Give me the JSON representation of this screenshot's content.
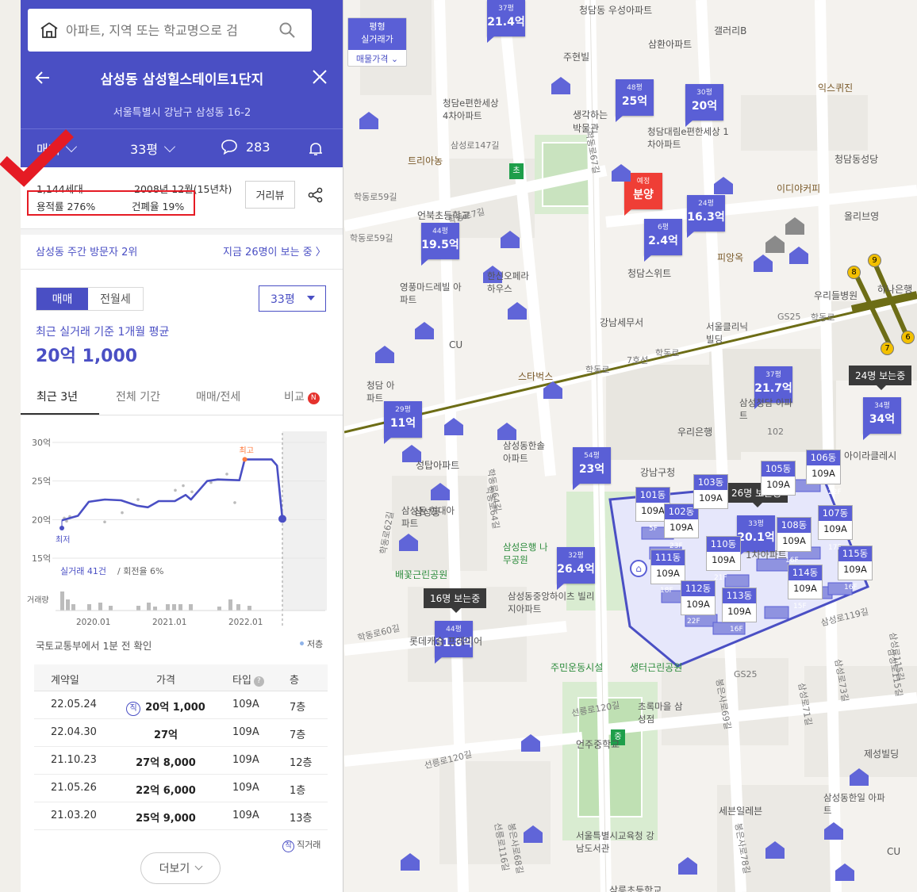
{
  "search": {
    "placeholder": "아파트, 지역 또는 학교명으로 검"
  },
  "header": {
    "title": "삼성동 삼성힐스테이트1단지",
    "address": "서울특별시 강남구 삼성동 16-2",
    "tabs": {
      "deal": "매매",
      "size": "33평",
      "comments": "283"
    }
  },
  "summary": {
    "households": "1,144세대",
    "built": "2008년 12월(15년차)",
    "far": "용적률 276%",
    "bcr": "건폐율 19%",
    "distance_view": "거리뷰"
  },
  "visit": {
    "rank": "삼성동 주간 방문자 2위",
    "viewing": "지금 26명이 보는 중 〉"
  },
  "price": {
    "mode_on": "매매",
    "mode_off": "전월세",
    "size_select": "33평",
    "avg_label": "최근 실거래 기준 1개월 평균",
    "avg_value": "20억 1,000"
  },
  "period_tabs": [
    "최근 3년",
    "전체 기간",
    "매매/전세",
    "비교"
  ],
  "compare_badge": "N",
  "chart_data": {
    "type": "line",
    "y_labels": [
      "30억",
      "25억",
      "20억",
      "15억"
    ],
    "x_labels": [
      "2020.01",
      "2021.01",
      "2022.01"
    ],
    "ylim": [
      15,
      30
    ],
    "series": [
      {
        "values": [
          {
            "x": "2019.06",
            "y": 19.9
          },
          {
            "x": "2019.09",
            "y": 20.5
          },
          {
            "x": "2019.11",
            "y": 22.3
          },
          {
            "x": "2020.02",
            "y": 22.6
          },
          {
            "x": "2020.05",
            "y": 22.5
          },
          {
            "x": "2020.08",
            "y": 21.8
          },
          {
            "x": "2020.10",
            "y": 21.6
          },
          {
            "x": "2020.12",
            "y": 22.4
          },
          {
            "x": "2021.03",
            "y": 22.4
          },
          {
            "x": "2021.05",
            "y": 23.2
          },
          {
            "x": "2021.06",
            "y": 22.6
          },
          {
            "x": "2021.09",
            "y": 25.0
          },
          {
            "x": "2021.11",
            "y": 25.2
          },
          {
            "x": "2022.03",
            "y": 25.1
          },
          {
            "x": "2022.04",
            "y": 27.8
          },
          {
            "x": "2022.06",
            "y": 27.8
          },
          {
            "x": "2022.09",
            "y": 27.8
          },
          {
            "x": "2022.10",
            "y": 27.0
          },
          {
            "x": "2022.11",
            "y": 20.1
          }
        ]
      }
    ],
    "annotations": {
      "high": "최고",
      "low": "최저"
    },
    "volume_label": "거래량",
    "stats_count": "실거래 41건",
    "stats_rotation": "/ 회전율 6%"
  },
  "confirm": "국토교통부에서 1분 전 확인",
  "low_legend": "저층",
  "table": {
    "headers": [
      "계약일",
      "가격",
      "타입",
      "층"
    ],
    "rows": [
      {
        "date": "22.05.24",
        "price": "20억 1,000",
        "type": "109A",
        "floor": "7층",
        "direct": true
      },
      {
        "date": "22.04.30",
        "price": "27억",
        "type": "109A",
        "floor": "7층",
        "direct": false
      },
      {
        "date": "21.10.23",
        "price": "27억 8,000",
        "type": "109A",
        "floor": "12층",
        "direct": false
      },
      {
        "date": "21.05.26",
        "price": "22억 6,000",
        "type": "109A",
        "floor": "1층",
        "direct": false
      },
      {
        "date": "21.03.20",
        "price": "25억 9,000",
        "type": "109A",
        "floor": "13층",
        "direct": false
      }
    ],
    "direct_mark": "직",
    "direct_legend": "직거래"
  },
  "more": "더보기",
  "map": {
    "type_toggle": "평형",
    "type_toggle2": "실거래가",
    "listing_toggle": "매물가격",
    "markers": [
      {
        "p": "37평",
        "v": "21.4억"
      },
      {
        "p": "48평",
        "v": "25억"
      },
      {
        "p": "30평",
        "v": "20억"
      },
      {
        "p": "예정",
        "v": "분양"
      },
      {
        "p": "6평",
        "v": "2.4억"
      },
      {
        "p": "24평",
        "v": "16.3억"
      },
      {
        "p": "44평",
        "v": "19.5억"
      },
      {
        "p": "37평",
        "v": "21.7억"
      },
      {
        "p": "34평",
        "v": "34억"
      },
      {
        "p": "29평",
        "v": "11억"
      },
      {
        "p": "54평",
        "v": "23억"
      },
      {
        "p": "33평",
        "v": "20.1억"
      },
      {
        "p": "32평",
        "v": "26.4억"
      },
      {
        "p": "44평",
        "v": "31.8억"
      }
    ],
    "bubbles": [
      "24명 보는중",
      "26명 보는중",
      "16명 보는중"
    ],
    "dongs": [
      {
        "d": "101동",
        "t": "109A",
        "f": "5F"
      },
      {
        "d": "102동",
        "t": "109A",
        "f": "23F"
      },
      {
        "d": "103동",
        "t": "109A",
        "f": ""
      },
      {
        "d": "105동",
        "t": "109A",
        "f": ""
      },
      {
        "d": "106동",
        "t": "109A",
        "f": "22F"
      },
      {
        "d": "107동",
        "t": "109A",
        "f": "17F"
      },
      {
        "d": "108동",
        "t": "109A",
        "f": "16F"
      },
      {
        "d": "110동",
        "t": "109A",
        "f": "21F"
      },
      {
        "d": "111동",
        "t": "109A",
        "f": "18F"
      },
      {
        "d": "112동",
        "t": "109A",
        "f": "22F"
      },
      {
        "d": "113동",
        "t": "109A",
        "f": "16F"
      },
      {
        "d": "114동",
        "t": "109A",
        "f": "15F"
      },
      {
        "d": "115동",
        "t": "109A",
        "f": "16F"
      }
    ],
    "labels": [
      "청담동 우성아파트",
      "갤러리B",
      "삼환아파트",
      "주현빌",
      "익스퀴진",
      "청담e편한세상 4차아파트",
      "생각하는 박물관",
      "청담대림e편한세상 1차아파트",
      "삼성로147길",
      "트리아농",
      "청담동성당",
      "이디야커피",
      "올리브영",
      "학동로59길",
      "언북초등학교",
      "학동로59길",
      "영풍마드레빌 아파트",
      "한신오페라 하우스",
      "청담스위트",
      "피앙옥",
      "하나은행",
      "우리들병원",
      "GS25",
      "학동로",
      "서울클리닉 빌딩",
      "강남세무서",
      "CU",
      "스타벅스",
      "학동로",
      "7호선",
      "학동로",
      "청담 아파트",
      "삼성청담 아파트",
      "102",
      "우리은행",
      "아이라클레시",
      "삼성동한솔 아파트",
      "성탑아파트",
      "강남구청",
      "삼성동 현대아파트",
      "학동로64길",
      "배꽃근린공원",
      "삼성은행 나무공원",
      "삼성동중앙하이츠 빌리지아파트",
      "롯데캐슬 프레미어",
      "학동로60길",
      "주민운동시설",
      "생터근린공원",
      "GS25",
      "선릉로120길",
      "초록마을 삼성점",
      "언주중학교",
      "선릉로120길",
      "세븐일레븐",
      "삼성동한일 아파트",
      "제성빌딩",
      "서울특별시교육청 강남도서관",
      "CU",
      "삼성로119길",
      "봉은사로69길",
      "삼성로71길",
      "삼성로73길",
      "삼성로115길",
      "선릉로116길",
      "봉은사로68길",
      "봉은사로78길",
      "삼성로115길",
      "삼릉초등학교",
      "학동로67길",
      "학동로7길",
      "학동로64길",
      "학동로62길",
      "삼성동",
      "1차아파트"
    ]
  }
}
